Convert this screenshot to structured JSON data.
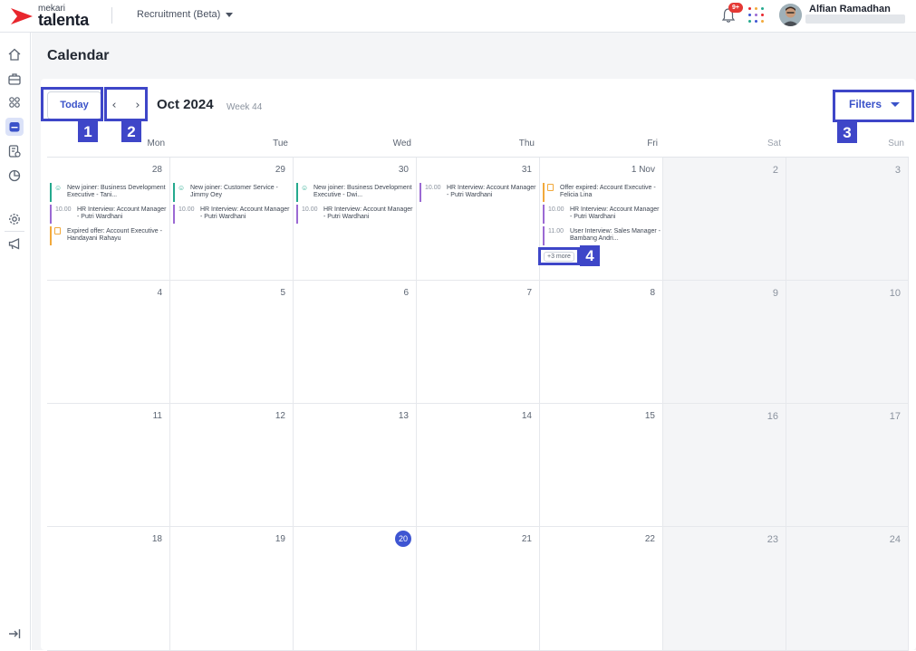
{
  "app": {
    "brand_small": "mekari",
    "brand_big": "talenta",
    "product": "Recruitment (Beta)",
    "notifications": "9+",
    "user": "Alfian Ramadhan"
  },
  "page": {
    "title": "Calendar"
  },
  "toolbar": {
    "today": "Today",
    "prev": "‹",
    "next": "›",
    "month": "Oct 2024",
    "week": "Week 44",
    "filters": "Filters"
  },
  "annotations": [
    "1",
    "2",
    "3",
    "4"
  ],
  "weekdays": [
    "Mon",
    "Tue",
    "Wed",
    "Thu",
    "Fri",
    "Sat",
    "Sun"
  ],
  "weeks": [
    {
      "days": [
        "28",
        "29",
        "30",
        "31",
        "1 Nov",
        "2",
        "3"
      ]
    },
    {
      "days": [
        "4",
        "5",
        "6",
        "7",
        "8",
        "9",
        "10"
      ]
    },
    {
      "days": [
        "11",
        "12",
        "13",
        "14",
        "15",
        "16",
        "17"
      ]
    },
    {
      "days": [
        "18",
        "19",
        "20",
        "21",
        "22",
        "23",
        "24"
      ]
    }
  ],
  "today_day": "20",
  "events": {
    "mon": [
      {
        "text": "New joiner: Business Development Executive - Tani...",
        "color": "#25a98e",
        "icon": "person-icon"
      },
      {
        "time": "10.00",
        "text": "HR Interview: Account Manager - Putri Wardhani",
        "color": "#9b6ad3"
      },
      {
        "text": "Expired offer: Account Executive - Handayani Rahayu",
        "color": "#f2a93b",
        "icon": "document-icon"
      }
    ],
    "tue": [
      {
        "text": "New joiner: Customer Service - Jimmy Oey",
        "color": "#25a98e",
        "icon": "person-icon"
      },
      {
        "time": "10.00",
        "text": "HR Interview: Account Manager - Putri Wardhani",
        "color": "#9b6ad3"
      }
    ],
    "wed": [
      {
        "text": "New joiner: Business Development Executive - Dwi...",
        "color": "#25a98e",
        "icon": "person-icon"
      },
      {
        "time": "10.00",
        "text": "HR Interview: Account Manager - Putri Wardhani",
        "color": "#9b6ad3"
      }
    ],
    "thu": [
      {
        "time": "10.00",
        "text": "HR Interview: Account Manager - Putri Wardhani",
        "color": "#9b6ad3"
      }
    ],
    "fri": [
      {
        "text": "Offer expired: Account Executive - Felicia Lina",
        "color": "#f2a93b",
        "icon": "document-icon"
      },
      {
        "time": "10.00",
        "text": "HR Interview: Account Manager - Putri Wardhani",
        "color": "#9b6ad3"
      },
      {
        "time": "11.00",
        "text": "User Interview: Sales Manager - Bambang Andri...",
        "color": "#9b6ad3"
      }
    ],
    "fri_more": "+3 more"
  }
}
